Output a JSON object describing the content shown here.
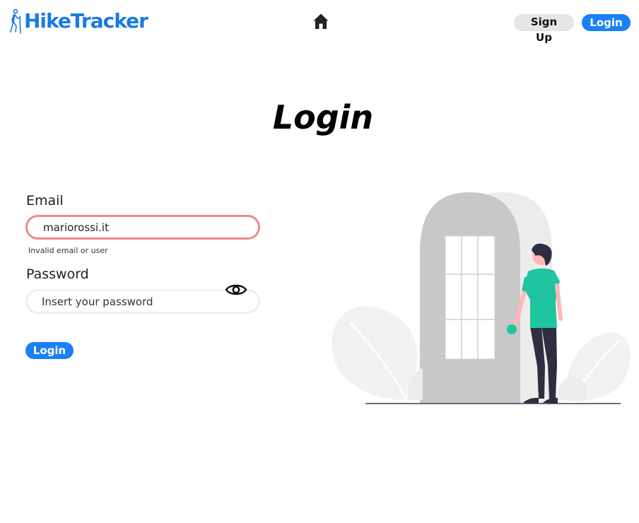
{
  "nav": {
    "brand": "HikeTracker",
    "home_icon": "home-icon",
    "signup_label": "Sign Up",
    "login_label": "Login"
  },
  "page": {
    "title": "Login"
  },
  "form": {
    "email_label": "Email",
    "email_value": "mariorossi.it",
    "email_error": "Invalid email or user",
    "password_label": "Password",
    "password_placeholder": "Insert your password",
    "password_toggle_icon": "eye-icon",
    "submit_label": "Login"
  },
  "colors": {
    "brand_blue": "#1a80f5",
    "error_border": "#f08a8a",
    "signup_bg": "#e6e6e6",
    "illustration_accent": "#1fc4a0"
  }
}
